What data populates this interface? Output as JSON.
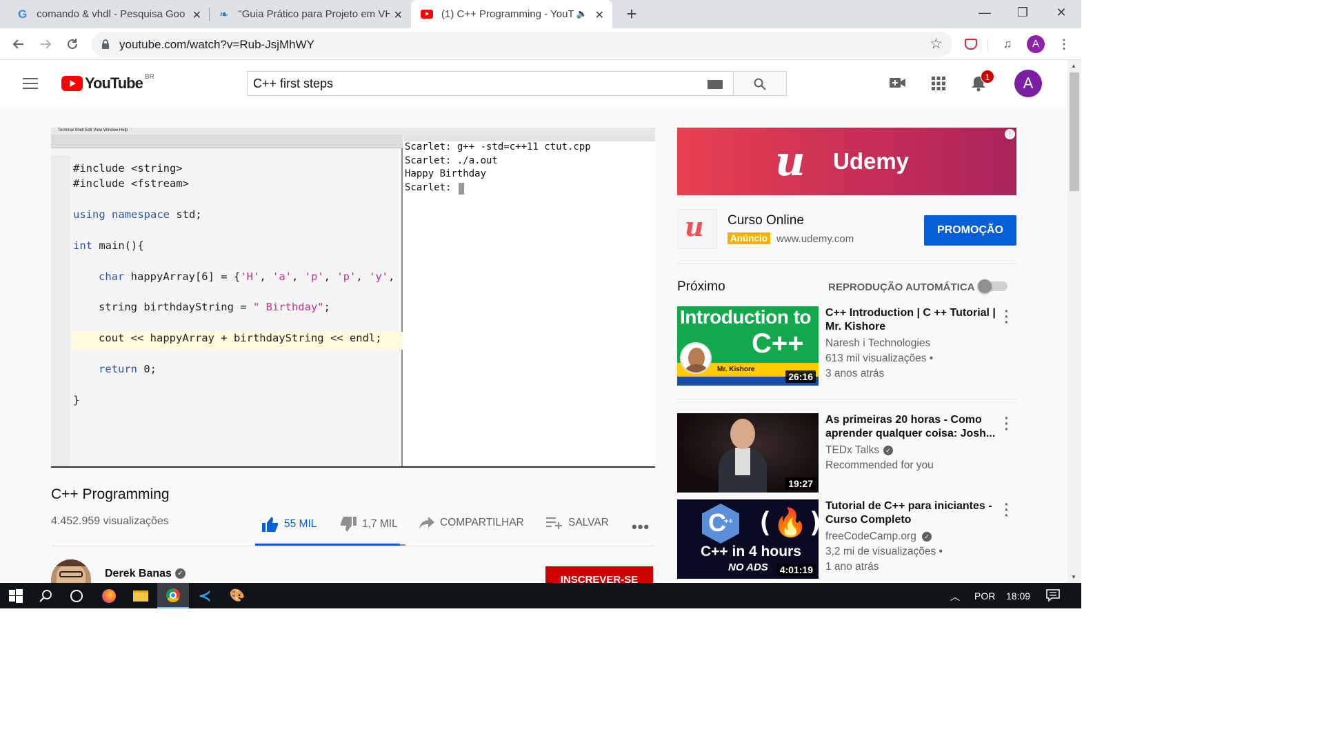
{
  "browser": {
    "tabs": [
      {
        "title": "comando & vhdl - Pesquisa Goo",
        "icon": "google-icon"
      },
      {
        "title": "\"Guia Prático para Projeto em VH",
        "icon": "book-icon"
      },
      {
        "title": "(1) C++ Programming - YouT",
        "icon": "youtube-icon",
        "active": true
      }
    ],
    "url": "youtube.com/watch?v=Rub-JsjMhWY",
    "profile_initial": "A"
  },
  "youtube": {
    "logo_text": "YouTube",
    "logo_region": "BR",
    "search_value": "C++ first steps",
    "notification_count": "1",
    "avatar_initial": "A",
    "video": {
      "terminal_lines": [
        "Scarlet: g++ -std=c++11 ctut.cpp",
        "Scarlet: ./a.out",
        "Happy Birthday",
        "Scarlet: "
      ],
      "title": "C++ Programming",
      "views": "4.452.959 visualizações",
      "likes": "55 MIL",
      "dislikes": "1,7 MIL",
      "share_label": "COMPARTILHAR",
      "save_label": "SALVAR",
      "channel": "Derek Banas",
      "subscribe_label": "INSCREVER-SE"
    },
    "ad": {
      "brand": "Udemy",
      "title": "Curso Online",
      "badge": "Anúncio",
      "domain": "www.udemy.com",
      "cta": "PROMOÇÃO"
    },
    "up_next_label": "Próximo",
    "autoplay_label": "REPRODUÇÃO AUTOMÁTICA",
    "recommendations": [
      {
        "title": "C++ Introduction | C ++ Tutorial | Mr. Kishore",
        "channel": "Naresh i Technologies",
        "views": "613 mil visualizações •",
        "age": "3 anos atrás",
        "duration": "26:16",
        "thumb_text_1": "Introduction to",
        "thumb_text_2": "C++",
        "thumb_name": "Mr. Kishore"
      },
      {
        "title": "As primeiras 20 horas - Como aprender qualquer coisa: Josh...",
        "channel": "TEDx Talks",
        "views": "Recommended for you",
        "age": "",
        "duration": "19:27",
        "verified": true
      },
      {
        "title": "Tutorial de C++ para iniciantes - Curso Completo",
        "channel": "freeCodeCamp.org",
        "views": "3,2 mi de visualizações •",
        "age": "1 ano atrás",
        "duration": "4:01:19",
        "thumb_text_1": "C++ in 4 hours",
        "thumb_text_2": "NO ADS",
        "verified": true
      }
    ]
  },
  "taskbar": {
    "language": "POR",
    "time": "18:09"
  },
  "colors": {
    "youtube_red": "#ff0000",
    "link_blue": "#065fd4",
    "subscribe_red": "#cc0000",
    "udemy_red": "#e8404f"
  }
}
